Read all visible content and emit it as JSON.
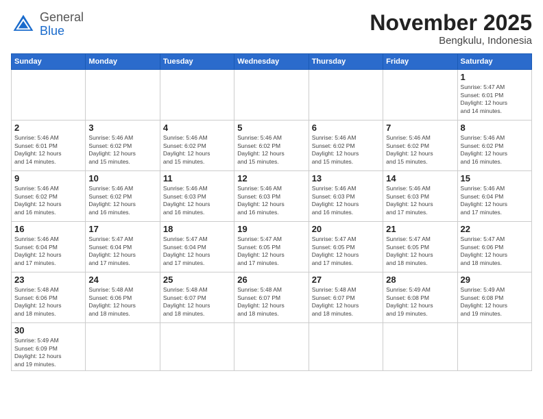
{
  "header": {
    "logo_general": "General",
    "logo_blue": "Blue",
    "month_title": "November 2025",
    "location": "Bengkulu, Indonesia"
  },
  "weekdays": [
    "Sunday",
    "Monday",
    "Tuesday",
    "Wednesday",
    "Thursday",
    "Friday",
    "Saturday"
  ],
  "days": {
    "1": {
      "sunrise": "5:47 AM",
      "sunset": "6:01 PM",
      "daylight": "12 hours and 14 minutes."
    },
    "2": {
      "sunrise": "5:46 AM",
      "sunset": "6:01 PM",
      "daylight": "12 hours and 14 minutes."
    },
    "3": {
      "sunrise": "5:46 AM",
      "sunset": "6:02 PM",
      "daylight": "12 hours and 15 minutes."
    },
    "4": {
      "sunrise": "5:46 AM",
      "sunset": "6:02 PM",
      "daylight": "12 hours and 15 minutes."
    },
    "5": {
      "sunrise": "5:46 AM",
      "sunset": "6:02 PM",
      "daylight": "12 hours and 15 minutes."
    },
    "6": {
      "sunrise": "5:46 AM",
      "sunset": "6:02 PM",
      "daylight": "12 hours and 15 minutes."
    },
    "7": {
      "sunrise": "5:46 AM",
      "sunset": "6:02 PM",
      "daylight": "12 hours and 15 minutes."
    },
    "8": {
      "sunrise": "5:46 AM",
      "sunset": "6:02 PM",
      "daylight": "12 hours and 16 minutes."
    },
    "9": {
      "sunrise": "5:46 AM",
      "sunset": "6:02 PM",
      "daylight": "12 hours and 16 minutes."
    },
    "10": {
      "sunrise": "5:46 AM",
      "sunset": "6:02 PM",
      "daylight": "12 hours and 16 minutes."
    },
    "11": {
      "sunrise": "5:46 AM",
      "sunset": "6:03 PM",
      "daylight": "12 hours and 16 minutes."
    },
    "12": {
      "sunrise": "5:46 AM",
      "sunset": "6:03 PM",
      "daylight": "12 hours and 16 minutes."
    },
    "13": {
      "sunrise": "5:46 AM",
      "sunset": "6:03 PM",
      "daylight": "12 hours and 16 minutes."
    },
    "14": {
      "sunrise": "5:46 AM",
      "sunset": "6:03 PM",
      "daylight": "12 hours and 17 minutes."
    },
    "15": {
      "sunrise": "5:46 AM",
      "sunset": "6:04 PM",
      "daylight": "12 hours and 17 minutes."
    },
    "16": {
      "sunrise": "5:46 AM",
      "sunset": "6:04 PM",
      "daylight": "12 hours and 17 minutes."
    },
    "17": {
      "sunrise": "5:47 AM",
      "sunset": "6:04 PM",
      "daylight": "12 hours and 17 minutes."
    },
    "18": {
      "sunrise": "5:47 AM",
      "sunset": "6:04 PM",
      "daylight": "12 hours and 17 minutes."
    },
    "19": {
      "sunrise": "5:47 AM",
      "sunset": "6:05 PM",
      "daylight": "12 hours and 17 minutes."
    },
    "20": {
      "sunrise": "5:47 AM",
      "sunset": "6:05 PM",
      "daylight": "12 hours and 17 minutes."
    },
    "21": {
      "sunrise": "5:47 AM",
      "sunset": "6:05 PM",
      "daylight": "12 hours and 18 minutes."
    },
    "22": {
      "sunrise": "5:47 AM",
      "sunset": "6:06 PM",
      "daylight": "12 hours and 18 minutes."
    },
    "23": {
      "sunrise": "5:48 AM",
      "sunset": "6:06 PM",
      "daylight": "12 hours and 18 minutes."
    },
    "24": {
      "sunrise": "5:48 AM",
      "sunset": "6:06 PM",
      "daylight": "12 hours and 18 minutes."
    },
    "25": {
      "sunrise": "5:48 AM",
      "sunset": "6:07 PM",
      "daylight": "12 hours and 18 minutes."
    },
    "26": {
      "sunrise": "5:48 AM",
      "sunset": "6:07 PM",
      "daylight": "12 hours and 18 minutes."
    },
    "27": {
      "sunrise": "5:48 AM",
      "sunset": "6:07 PM",
      "daylight": "12 hours and 18 minutes."
    },
    "28": {
      "sunrise": "5:49 AM",
      "sunset": "6:08 PM",
      "daylight": "12 hours and 19 minutes."
    },
    "29": {
      "sunrise": "5:49 AM",
      "sunset": "6:08 PM",
      "daylight": "12 hours and 19 minutes."
    },
    "30": {
      "sunrise": "5:49 AM",
      "sunset": "6:09 PM",
      "daylight": "12 hours and 19 minutes."
    }
  }
}
